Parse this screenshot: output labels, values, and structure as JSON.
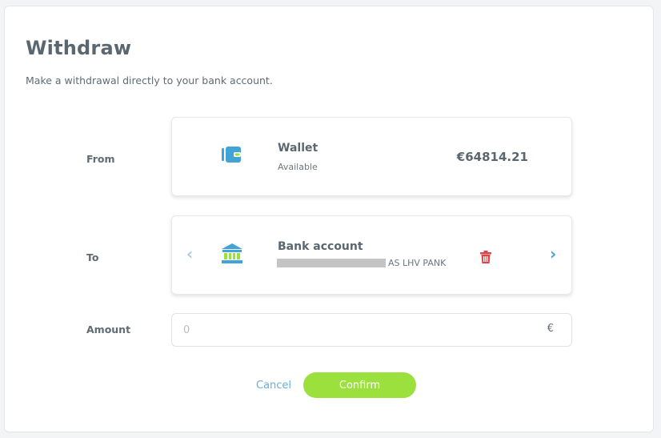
{
  "header": {
    "title": "Withdraw",
    "subtitle": "Make a withdrawal directly to your bank account."
  },
  "from": {
    "label": "From",
    "icon": "wallet-icon",
    "name": "Wallet",
    "sub": "Available",
    "balance": "€64814.21"
  },
  "to": {
    "label": "To",
    "icon": "bank-icon",
    "name": "Bank account",
    "bank_name": "AS LHV PANK",
    "prev_icon": "‹",
    "next_icon": "›",
    "delete_icon": "trash-icon"
  },
  "amount": {
    "label": "Amount",
    "placeholder": "0",
    "value": "",
    "currency": "€"
  },
  "actions": {
    "cancel_label": "Cancel",
    "confirm_label": "Confirm"
  },
  "colors": {
    "accent_green": "#9be03c",
    "link_blue": "#6aaed6",
    "icon_blue": "#41a3d6",
    "delete_red": "#d9454a"
  }
}
